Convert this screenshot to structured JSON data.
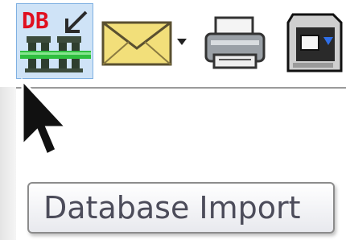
{
  "toolbar": {
    "buttons": [
      {
        "icon": "database-import-icon",
        "icon_text": "DB",
        "state": "hover"
      },
      {
        "icon": "email-envelope-icon",
        "has_dropdown": true
      },
      {
        "icon": "printer-icon"
      },
      {
        "icon": "fax-machine-icon"
      }
    ]
  },
  "tooltip": {
    "text": "Database Import"
  },
  "colors": {
    "hover_background": "#cfe3f7",
    "hover_border": "#7fb0e2",
    "db_text": "#e01020",
    "tooltip_text": "#4c4c5a"
  }
}
